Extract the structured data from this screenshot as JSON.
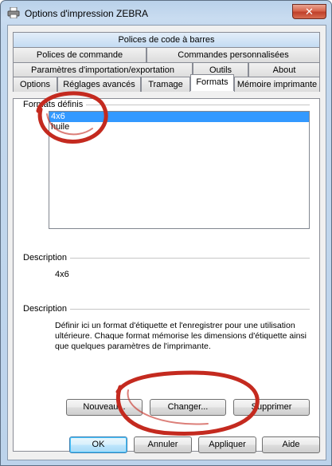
{
  "window": {
    "title": "Options d'impression ZEBRA",
    "close_label": "✕"
  },
  "tabs": {
    "row1": [
      {
        "label": "Polices de code à barres"
      }
    ],
    "row2": [
      {
        "label": "Polices de commande"
      },
      {
        "label": "Commandes personnalisées"
      }
    ],
    "row3": [
      {
        "label": "Paramètres d'importation/exportation"
      },
      {
        "label": "Outils"
      },
      {
        "label": "About"
      }
    ],
    "row4": [
      {
        "label": "Options"
      },
      {
        "label": "Réglages avancés"
      },
      {
        "label": "Tramage"
      },
      {
        "label": "Formats"
      },
      {
        "label": "Mémoire imprimante"
      }
    ],
    "active": "Formats"
  },
  "formats": {
    "group_label": "Formats définis",
    "items": [
      "4x6",
      "huile"
    ],
    "selected": "4x6"
  },
  "description1": {
    "label": "Description",
    "value": "4x6"
  },
  "description2": {
    "label": "Description",
    "text": "Définir ici un format d'étiquette et l'enregistrer pour une utilisation ultérieure. Chaque format mémorise les dimensions d'étiquette ainsi que quelques paramètres de l'imprimante."
  },
  "actions": {
    "new_label": "Nouveau...",
    "change_label": "Changer...",
    "delete_label": "Supprimer"
  },
  "footer": {
    "ok_label": "OK",
    "cancel_label": "Annuler",
    "apply_label": "Appliquer",
    "help_label": "Aide"
  },
  "icons": {
    "window_icon": "printer-icon"
  },
  "colors": {
    "selection": "#3399ff",
    "annotation": "#c42a1f"
  }
}
